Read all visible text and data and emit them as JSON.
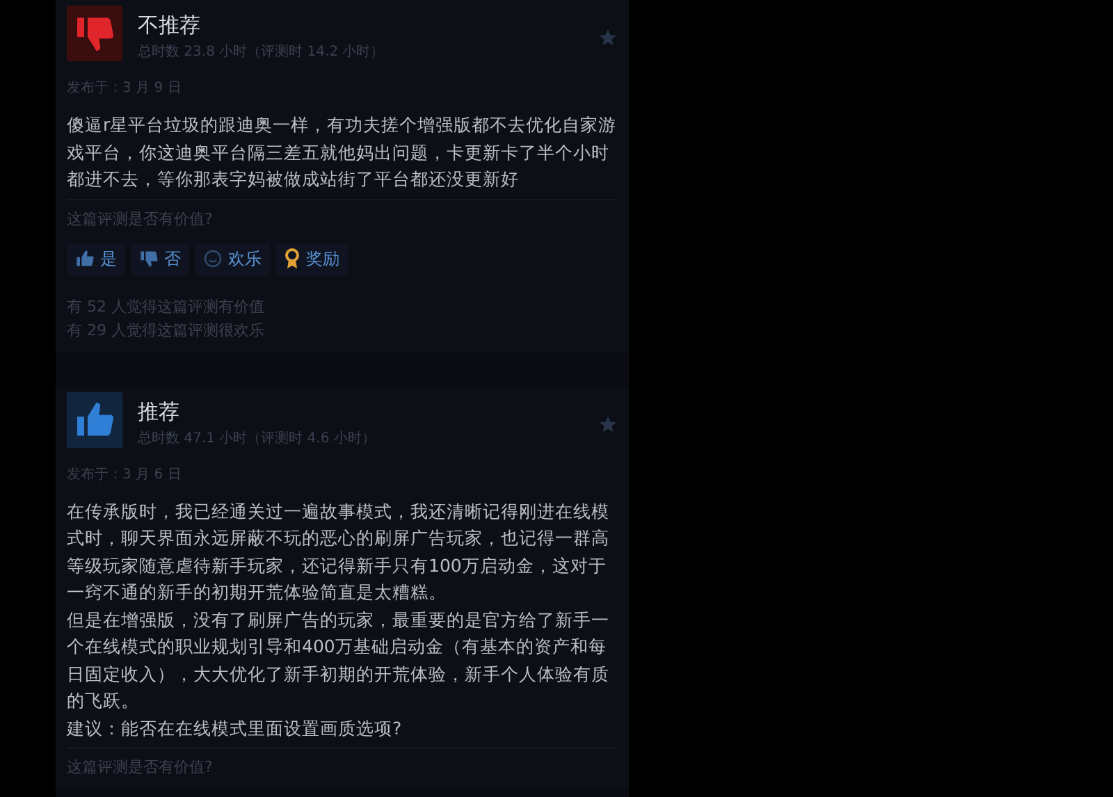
{
  "reviews": [
    {
      "kind": "negative",
      "verdict": "不推荐",
      "hours": "总时数 23.8 小时（评测时 14.2 小时）",
      "posted": "发布于：3 月 9 日",
      "paragraphs": [
        "傻逼r星平台垃圾的跟迪奥一样，有功夫搓个增强版都不去优化自家游戏平台，你这迪奥平台隔三差五就他妈出问题，卡更新卡了半个小时都进不去，等你那表字妈被做成站街了平台都还没更新好"
      ],
      "question": "这篇评测是否有价值?",
      "votes": [
        {
          "kind": "yes",
          "label": "是"
        },
        {
          "kind": "no",
          "label": "否"
        },
        {
          "kind": "funny",
          "label": "欢乐"
        },
        {
          "kind": "award",
          "label": "奖励"
        }
      ],
      "stats": [
        "有 52 人觉得这篇评测有价值",
        "有 29 人觉得这篇评测很欢乐"
      ]
    },
    {
      "kind": "positive",
      "verdict": "推荐",
      "hours": "总时数 47.1 小时（评测时 4.6 小时）",
      "posted": "发布于：3 月 6 日",
      "paragraphs": [
        "在传承版时，我已经通关过一遍故事模式，我还清晰记得刚进在线模式时，聊天界面永远屏蔽不玩的恶心的刷屏广告玩家，也记得一群高等级玩家随意虐待新手玩家，还记得新手只有100万启动金，这对于一窍不通的新手的初期开荒体验简直是太糟糕。",
        "但是在增强版，没有了刷屏广告的玩家，最重要的是官方给了新手一个在线模式的职业规划引导和400万基础启动金（有基本的资产和每日固定收入），大大优化了新手初期的开荒体验，新手个人体验有质的飞跃。",
        "建议：能否在在线模式里面设置画质选项?"
      ],
      "question": "这篇评测是否有价值?"
    }
  ]
}
